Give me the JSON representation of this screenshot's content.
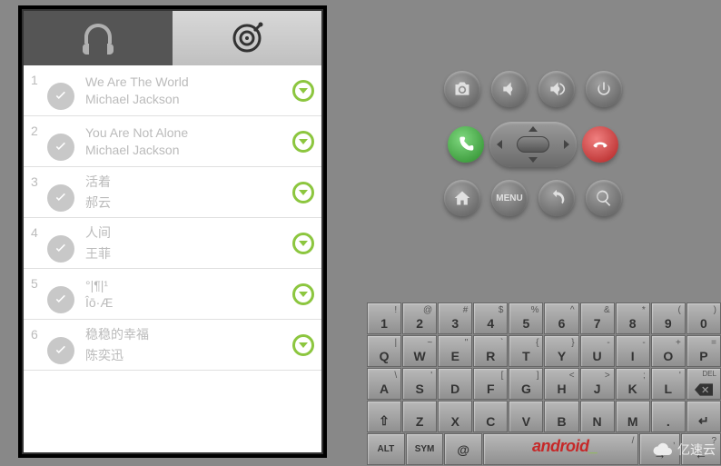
{
  "songs": [
    {
      "num": "1",
      "title": "We Are The World",
      "artist": "Michael Jackson"
    },
    {
      "num": "2",
      "title": "You Are Not Alone",
      "artist": "Michael Jackson"
    },
    {
      "num": "3",
      "title": "活着",
      "artist": "郝云"
    },
    {
      "num": "4",
      "title": "人间",
      "artist": "王菲"
    },
    {
      "num": "5",
      "title": "°|¶|¹",
      "artist": "Îō·Æ"
    },
    {
      "num": "6",
      "title": "稳稳的幸福",
      "artist": "陈奕迅"
    }
  ],
  "controls": {
    "menu_label": "MENU"
  },
  "keyboard": {
    "r1": [
      {
        "m": "1",
        "s": "!"
      },
      {
        "m": "2",
        "s": "@"
      },
      {
        "m": "3",
        "s": "#"
      },
      {
        "m": "4",
        "s": "$"
      },
      {
        "m": "5",
        "s": "%"
      },
      {
        "m": "6",
        "s": "^"
      },
      {
        "m": "7",
        "s": "&"
      },
      {
        "m": "8",
        "s": "*"
      },
      {
        "m": "9",
        "s": "("
      },
      {
        "m": "0",
        "s": ")"
      }
    ],
    "r2": [
      {
        "m": "Q",
        "s": "|"
      },
      {
        "m": "W",
        "s": "~"
      },
      {
        "m": "E",
        "s": "\""
      },
      {
        "m": "R",
        "s": "`"
      },
      {
        "m": "T",
        "s": "{"
      },
      {
        "m": "Y",
        "s": "}"
      },
      {
        "m": "U",
        "s": "-"
      },
      {
        "m": "I",
        "s": "-"
      },
      {
        "m": "O",
        "s": "+"
      },
      {
        "m": "P",
        "s": "="
      }
    ],
    "r3": [
      {
        "m": "A",
        "s": "\\"
      },
      {
        "m": "S",
        "s": "'"
      },
      {
        "m": "D",
        "s": ""
      },
      {
        "m": "F",
        "s": "["
      },
      {
        "m": "G",
        "s": "]"
      },
      {
        "m": "H",
        "s": "<"
      },
      {
        "m": "J",
        "s": ">"
      },
      {
        "m": "K",
        "s": ";"
      },
      {
        "m": "L",
        "s": "'"
      },
      {
        "m": "DEL",
        "s": ""
      }
    ],
    "r4": [
      {
        "m": "⇧",
        "s": ""
      },
      {
        "m": "Z",
        "s": ""
      },
      {
        "m": "X",
        "s": ""
      },
      {
        "m": "C",
        "s": ""
      },
      {
        "m": "V",
        "s": ""
      },
      {
        "m": "B",
        "s": ""
      },
      {
        "m": "N",
        "s": ""
      },
      {
        "m": "M",
        "s": ""
      },
      {
        "m": ".",
        "s": ""
      },
      {
        "m": "↵",
        "s": ""
      }
    ],
    "r5": {
      "alt": "ALT",
      "sym": "SYM",
      "at": "@",
      "slash": "/",
      "comma": ",",
      "question": "?"
    }
  },
  "brand": {
    "android": "android",
    "suffix": "_"
  },
  "watermark": "亿速云"
}
